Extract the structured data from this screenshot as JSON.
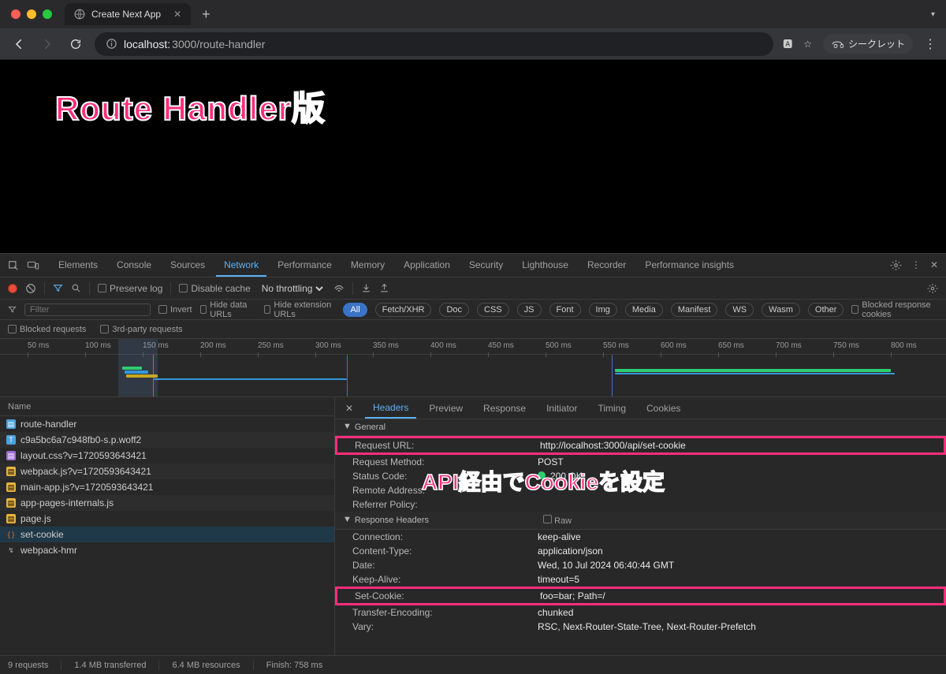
{
  "window": {
    "tab_title": "Create Next App",
    "incognito_label": "シークレット"
  },
  "address": {
    "host": "localhost:",
    "port_path": "3000/route-handler",
    "translate_tip": "Translate",
    "star_tip": "Bookmark"
  },
  "page": {
    "overlay_title": "Route Handler版"
  },
  "devtools": {
    "tabs": [
      "Elements",
      "Console",
      "Sources",
      "Network",
      "Performance",
      "Memory",
      "Application",
      "Security",
      "Lighthouse",
      "Recorder",
      "Performance insights"
    ],
    "active_tab": "Network",
    "toolbar": {
      "preserve_log": "Preserve log",
      "disable_cache": "Disable cache",
      "throttling": "No throttling"
    },
    "filter": {
      "placeholder": "Filter",
      "invert": "Invert",
      "hide_data": "Hide data URLs",
      "hide_ext": "Hide extension URLs",
      "types": [
        "All",
        "Fetch/XHR",
        "Doc",
        "CSS",
        "JS",
        "Font",
        "Img",
        "Media",
        "Manifest",
        "WS",
        "Wasm",
        "Other"
      ],
      "blocked_resp": "Blocked response cookies",
      "blocked_req": "Blocked requests",
      "third_party": "3rd-party requests"
    },
    "timeline_marks": [
      "50 ms",
      "100 ms",
      "150 ms",
      "200 ms",
      "250 ms",
      "300 ms",
      "350 ms",
      "400 ms",
      "450 ms",
      "500 ms",
      "550 ms",
      "600 ms",
      "650 ms",
      "700 ms",
      "750 ms",
      "800 ms"
    ],
    "name_col": "Name",
    "requests": [
      {
        "name": "route-handler",
        "icon": "doc"
      },
      {
        "name": "c9a5bc6a7c948fb0-s.p.woff2",
        "icon": "font"
      },
      {
        "name": "layout.css?v=1720593643421",
        "icon": "css"
      },
      {
        "name": "webpack.js?v=1720593643421",
        "icon": "js"
      },
      {
        "name": "main-app.js?v=1720593643421",
        "icon": "js"
      },
      {
        "name": "app-pages-internals.js",
        "icon": "js"
      },
      {
        "name": "page.js",
        "icon": "js"
      },
      {
        "name": "set-cookie",
        "icon": "fetch",
        "selected": true
      },
      {
        "name": "webpack-hmr",
        "icon": "ws"
      }
    ],
    "details": {
      "tabs": [
        "Headers",
        "Preview",
        "Response",
        "Initiator",
        "Timing",
        "Cookies"
      ],
      "active": "Headers",
      "general_label": "General",
      "resp_headers_label": "Response Headers",
      "raw_label": "Raw",
      "general": [
        {
          "k": "Request URL:",
          "v": "http://localhost:3000/api/set-cookie",
          "hi": true
        },
        {
          "k": "Request Method:",
          "v": "POST"
        },
        {
          "k": "Status Code:",
          "v": "200 OK",
          "status": true
        },
        {
          "k": "Remote Address:",
          "v": ""
        },
        {
          "k": "Referrer Policy:",
          "v": ""
        }
      ],
      "response_headers": [
        {
          "k": "Connection:",
          "v": "keep-alive"
        },
        {
          "k": "Content-Type:",
          "v": "application/json"
        },
        {
          "k": "Date:",
          "v": "Wed, 10 Jul 2024 06:40:44 GMT"
        },
        {
          "k": "Keep-Alive:",
          "v": "timeout=5"
        },
        {
          "k": "Set-Cookie:",
          "v": "foo=bar; Path=/",
          "hi": true
        },
        {
          "k": "Transfer-Encoding:",
          "v": "chunked"
        },
        {
          "k": "Vary:",
          "v": "RSC, Next-Router-State-Tree, Next-Router-Prefetch"
        }
      ],
      "overlay_annotation": "API経由でCookieを設定"
    },
    "status": {
      "requests": "9 requests",
      "transferred": "1.4 MB transferred",
      "resources": "6.4 MB resources",
      "finish": "Finish: 758 ms"
    }
  }
}
